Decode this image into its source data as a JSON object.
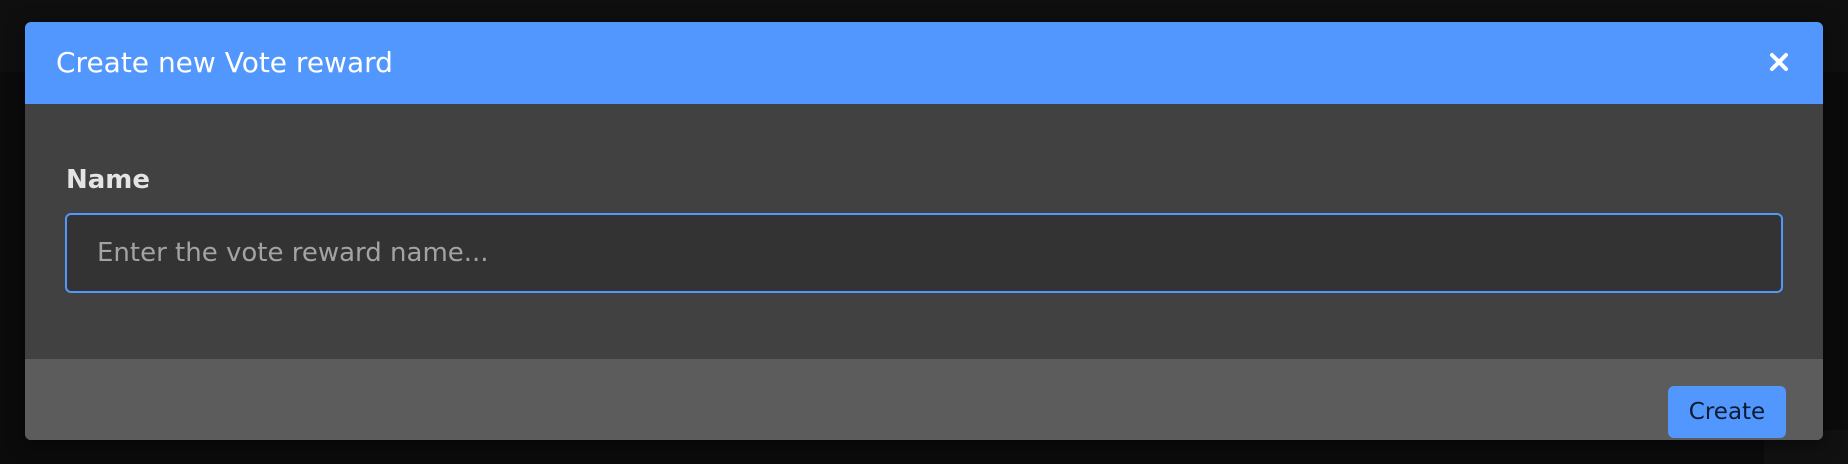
{
  "modal": {
    "title": "Create new Vote reward",
    "close_icon": "close-icon",
    "field": {
      "label": "Name",
      "value": "",
      "placeholder": "Enter the vote reward name..."
    },
    "footer": {
      "create_label": "Create"
    }
  },
  "colors": {
    "accent": "#5297fd",
    "modal_body": "#414141",
    "modal_footer": "#5c5c5c",
    "input_background": "#333333",
    "backdrop": "#0b0b0b"
  }
}
